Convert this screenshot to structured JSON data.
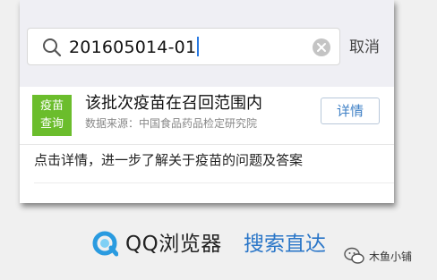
{
  "search": {
    "query": "201605014-01",
    "cancel_label": "取消"
  },
  "result": {
    "badge_line1": "疫苗",
    "badge_line2": "查询",
    "badge_color": "#6bbd2c",
    "title": "该批次疫苗在召回范围内",
    "source": "数据来源：中国食品药品检定研究院",
    "detail_label": "详情",
    "description": "点击详情，进一步了解关于疫苗的问题及答案"
  },
  "footer": {
    "brand": "QQ浏览器",
    "slogan": "搜索直达",
    "slogan_color": "#2a76c8"
  },
  "watermark": {
    "text": "木鱼小铺"
  }
}
